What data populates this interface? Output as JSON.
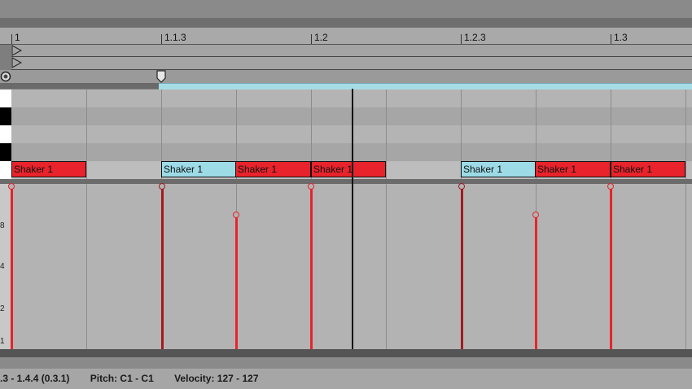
{
  "ruler": {
    "markers": [
      "1",
      "1.1.3",
      "1.2",
      "1.2.3",
      "1.3"
    ]
  },
  "notes": [
    {
      "label": "Shaker 1",
      "selected": false
    },
    {
      "label": "Shaker 1",
      "selected": true
    },
    {
      "label": "Shaker 1",
      "selected": false
    },
    {
      "label": "Shaker 1",
      "selected": false
    },
    {
      "label": "Shaker 1",
      "selected": true
    },
    {
      "label": "Shaker 1",
      "selected": false
    },
    {
      "label": "Shaker 1",
      "selected": false
    }
  ],
  "velocity": {
    "scale_labels": [
      "8",
      "4",
      "2",
      "1"
    ]
  },
  "status": {
    "time": ".3 - 1.4.4 (0.3.1)",
    "pitch": "Pitch: C1 - C1",
    "velocity": "Velocity: 127 - 127"
  },
  "colors": {
    "note_red": "#e8232b",
    "note_selected": "#9ddbe7",
    "loop_bar": "#a6dce6"
  },
  "icons": {
    "marker": "loop-marker-icon",
    "record": "record-icon"
  }
}
